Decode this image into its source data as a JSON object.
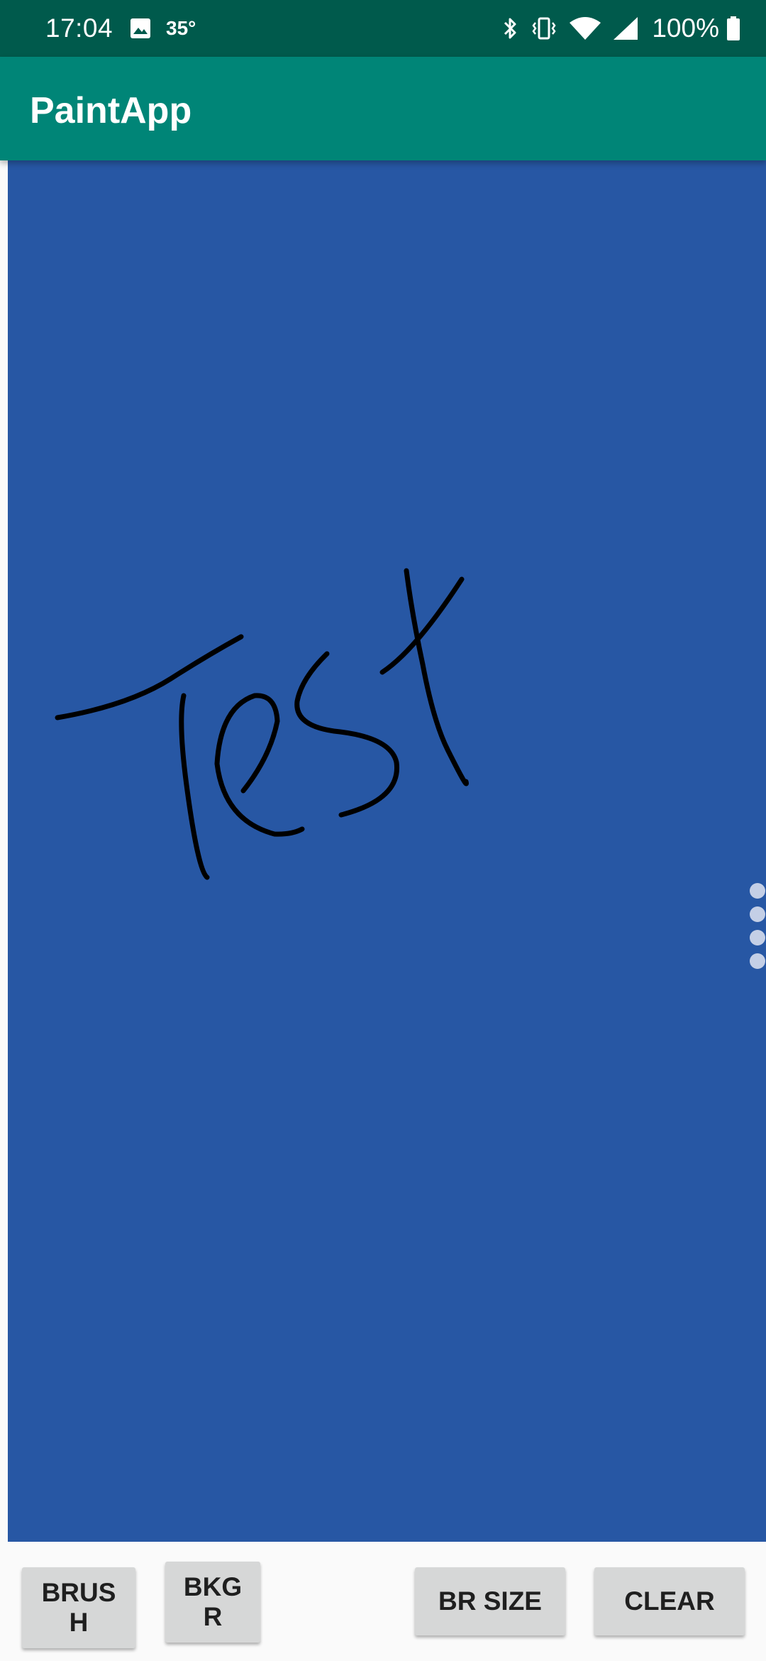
{
  "status_bar": {
    "time": "17:04",
    "temperature": "35°",
    "battery": "100%",
    "icons": [
      "photo-icon",
      "bluetooth-icon",
      "vibrate-icon",
      "wifi-icon",
      "signal-icon",
      "battery-icon"
    ]
  },
  "app_bar": {
    "title": "PaintApp",
    "color": "#008577"
  },
  "canvas": {
    "background_color": "#2757a4",
    "brush_color": "#000000",
    "page_indicator_count": 4
  },
  "toolbar": {
    "brush_label": "BRUSH",
    "background_label": "BKGR",
    "brush_size_label": "BR SIZE",
    "clear_label": "CLEAR"
  }
}
